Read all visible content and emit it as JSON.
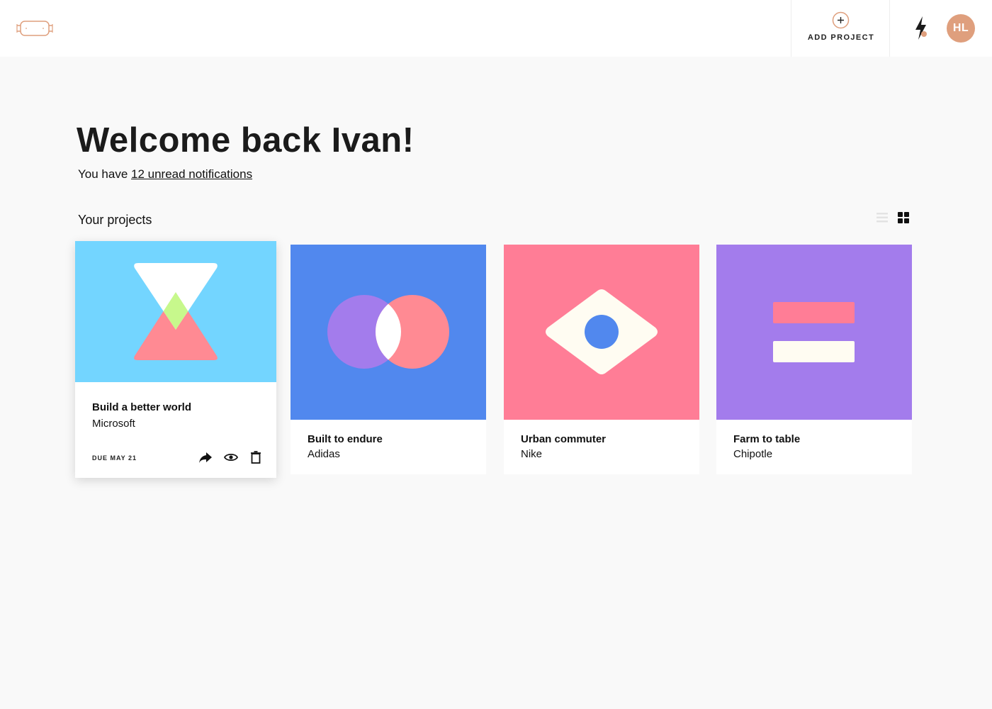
{
  "header": {
    "logo_name": "face-mask-logo",
    "add_project_label": "ADD PROJECT",
    "avatar_initials": "HL",
    "accent_color": "#df9f7d"
  },
  "welcome": {
    "title": "Welcome back Ivan!",
    "prefix": "You have ",
    "notifications_link": "12 unread notifications"
  },
  "projects": {
    "section_title": "Your projects",
    "view_mode": "grid",
    "items": [
      {
        "title": "Build a better world",
        "client": "Microsoft",
        "due": "DUE MAY 21",
        "color": "#73d5ff",
        "featured": true
      },
      {
        "title": "Built to endure",
        "client": "Adidas",
        "color": "#5188ee"
      },
      {
        "title": "Urban commuter",
        "client": "Nike",
        "color": "#ff7d96"
      },
      {
        "title": "Farm to table",
        "client": "Chipotle",
        "color": "#a37cec"
      }
    ]
  }
}
